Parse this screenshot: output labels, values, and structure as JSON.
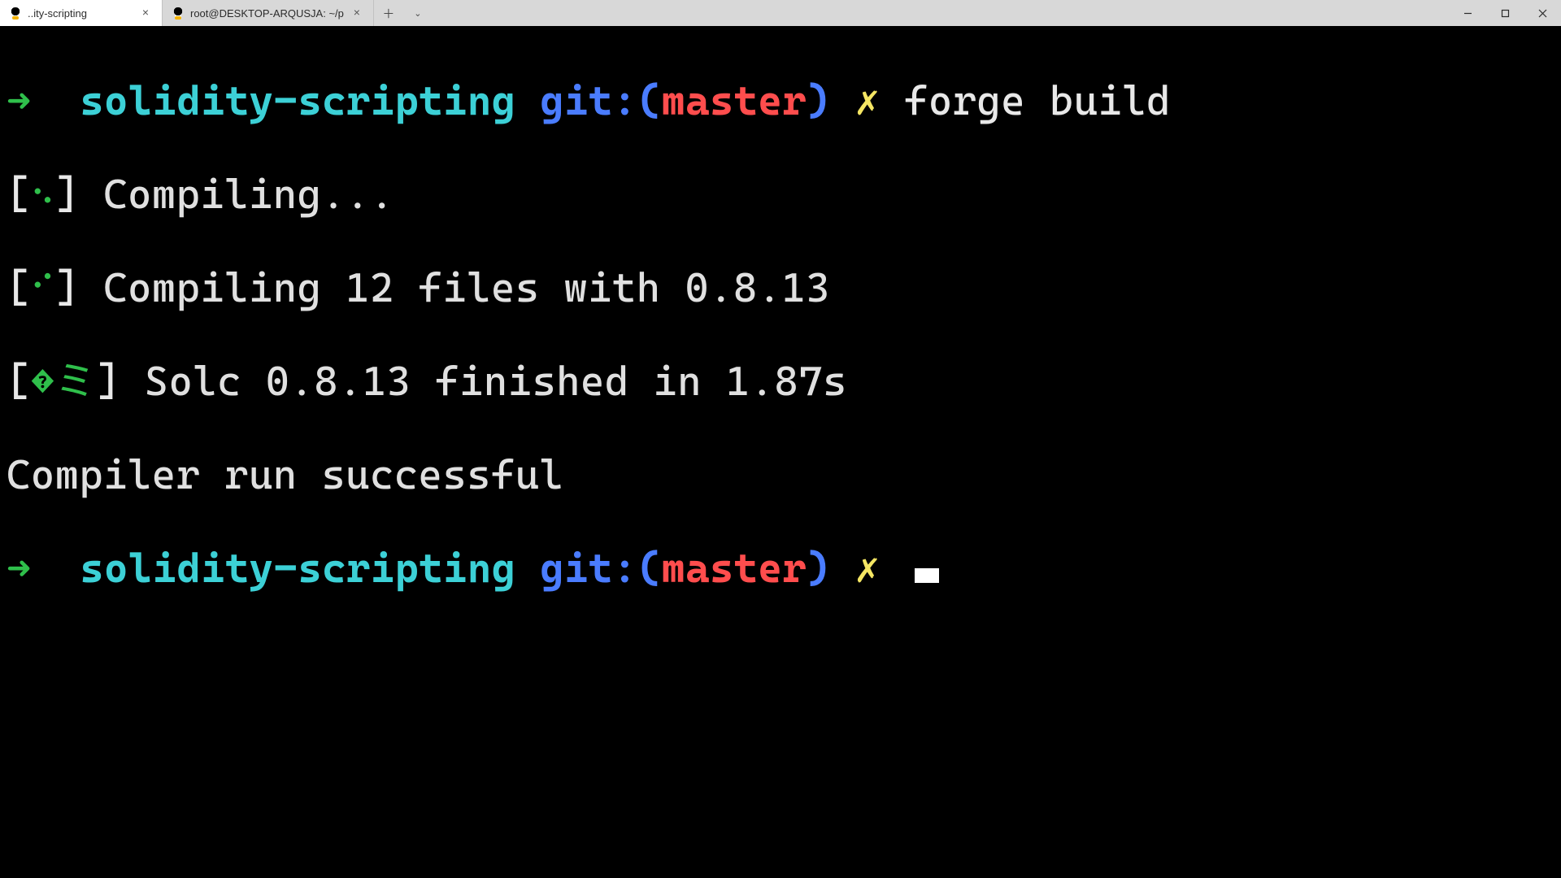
{
  "titlebar": {
    "tabs": [
      {
        "title": "..ity-scripting",
        "active": true
      },
      {
        "title": "root@DESKTOP-ARQUSJA: ~/p",
        "active": false
      }
    ],
    "new_tab_icon": "plus-icon",
    "tab_dropdown_icon": "chevron-down-icon"
  },
  "terminal": {
    "prompt1": {
      "arrow": "➜",
      "cwd": "solidity-scripting",
      "git_label": "git:",
      "paren_open": "(",
      "branch": "master",
      "paren_close": ")",
      "dirty": "✗",
      "command": "forge build"
    },
    "output": {
      "line1": {
        "open": "[",
        "dots": "⠢",
        "close": "]",
        "text": " Compiling..."
      },
      "line2": {
        "open": "[",
        "dots": "⠊",
        "close": "]",
        "text": " Compiling 12 files with 0.8.13"
      },
      "line3": {
        "open": "[",
        "dots": "�ミ",
        "close": "]",
        "text": " Solc 0.8.13 finished in 1.87s"
      },
      "line4": "Compiler run successful"
    },
    "prompt2": {
      "arrow": "➜",
      "cwd": "solidity-scripting",
      "git_label": "git:",
      "paren_open": "(",
      "branch": "master",
      "paren_close": ")",
      "dirty": "✗"
    }
  }
}
